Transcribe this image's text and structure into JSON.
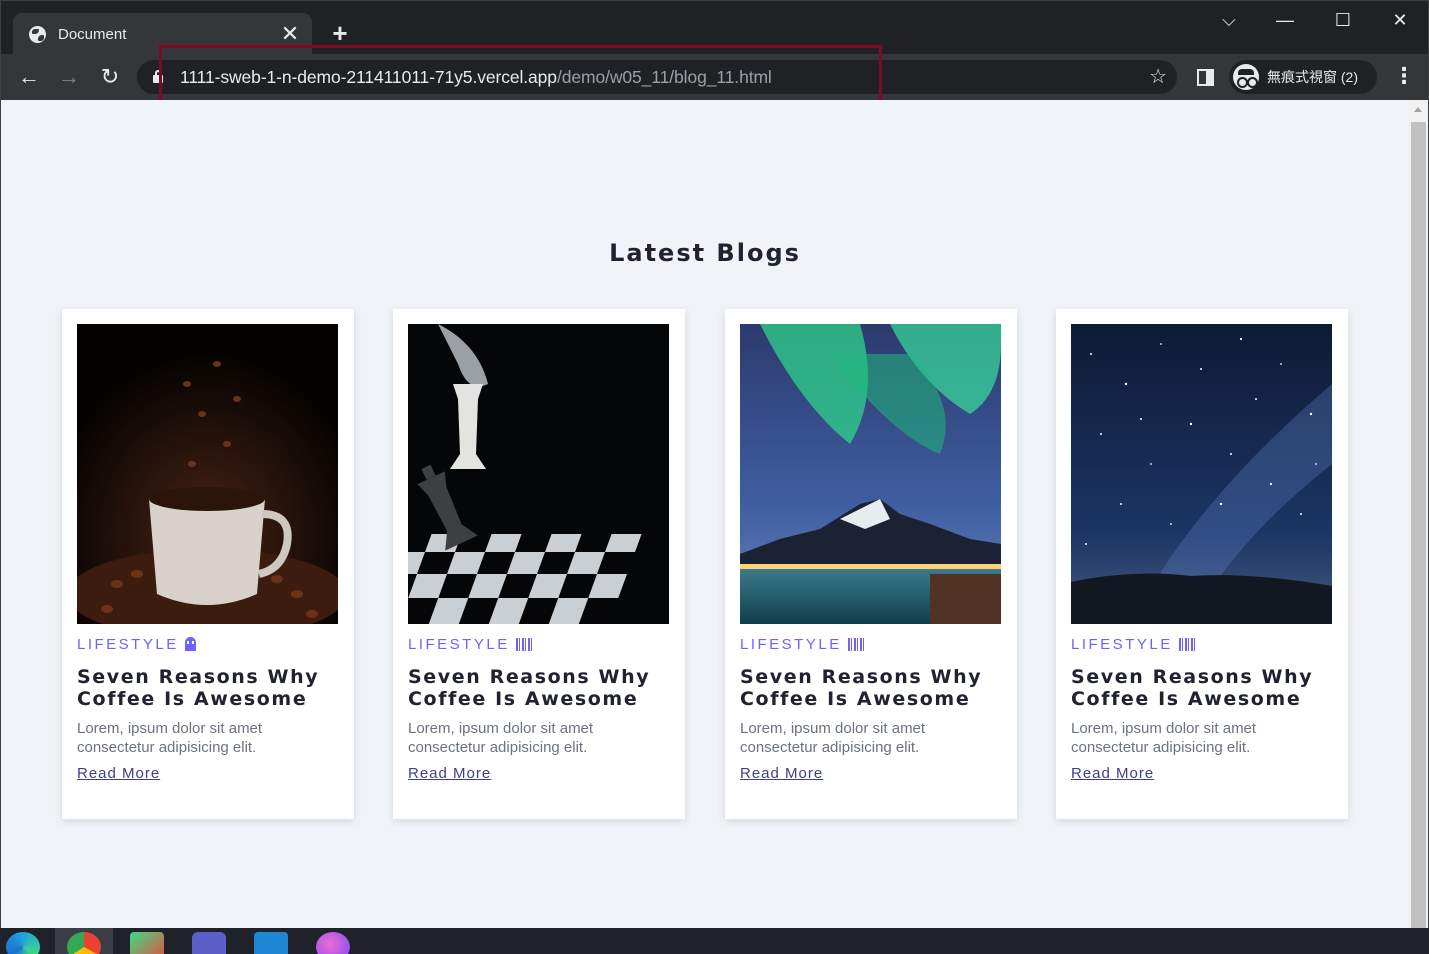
{
  "browser": {
    "tab_title": "Document",
    "tab_close": "✕",
    "new_tab": "+",
    "url_host": "1111-sweb-1-n-demo-211411011-71y5.vercel.app",
    "url_path": "/demo/w05_11/blog_11.html",
    "incognito_label": "無痕式視窗 (2)",
    "back": "←",
    "forward": "→",
    "reload": "↻",
    "star": "☆",
    "menu": "⋮",
    "win_dropdown": "⌵",
    "win_minimize": "—",
    "win_maximize": "☐",
    "win_close": "✕"
  },
  "page": {
    "heading": "Latest Blogs",
    "cards": [
      {
        "tag": "LIFESTYLE",
        "tag_icon": "ghost-icon",
        "title": "Seven Reasons Why Coffee Is Awesome",
        "desc": "Lorem, ipsum dolor sit amet consectetur adipisicing elit.",
        "link": "Read More",
        "image": "coffee-cup-photo"
      },
      {
        "tag": "LIFESTYLE",
        "tag_icon": "barcode-icon",
        "title": "Seven Reasons Why Coffee Is Awesome",
        "desc": "Lorem, ipsum dolor sit amet consectetur adipisicing elit.",
        "link": "Read More",
        "image": "chess-photo"
      },
      {
        "tag": "LIFESTYLE",
        "tag_icon": "barcode-icon",
        "title": "Seven Reasons Why Coffee Is Awesome",
        "desc": "Lorem, ipsum dolor sit amet consectetur adipisicing elit.",
        "link": "Read More",
        "image": "aurora-photo"
      },
      {
        "tag": "LIFESTYLE",
        "tag_icon": "barcode-icon",
        "title": "Seven Reasons Why Coffee Is Awesome",
        "desc": "Lorem, ipsum dolor sit amet consectetur adipisicing elit.",
        "link": "Read More",
        "image": "starry-sky-photo"
      }
    ]
  },
  "colors": {
    "accent": "#6c63ff",
    "link": "#3b3f8f",
    "page_bg": "#f0f4f8",
    "highlight": "#7d0a25"
  },
  "taskbar": {
    "apps": [
      "edge-icon",
      "chrome-icon",
      "app-icon",
      "teams-icon",
      "vscode-icon",
      "app-icon-2"
    ]
  }
}
